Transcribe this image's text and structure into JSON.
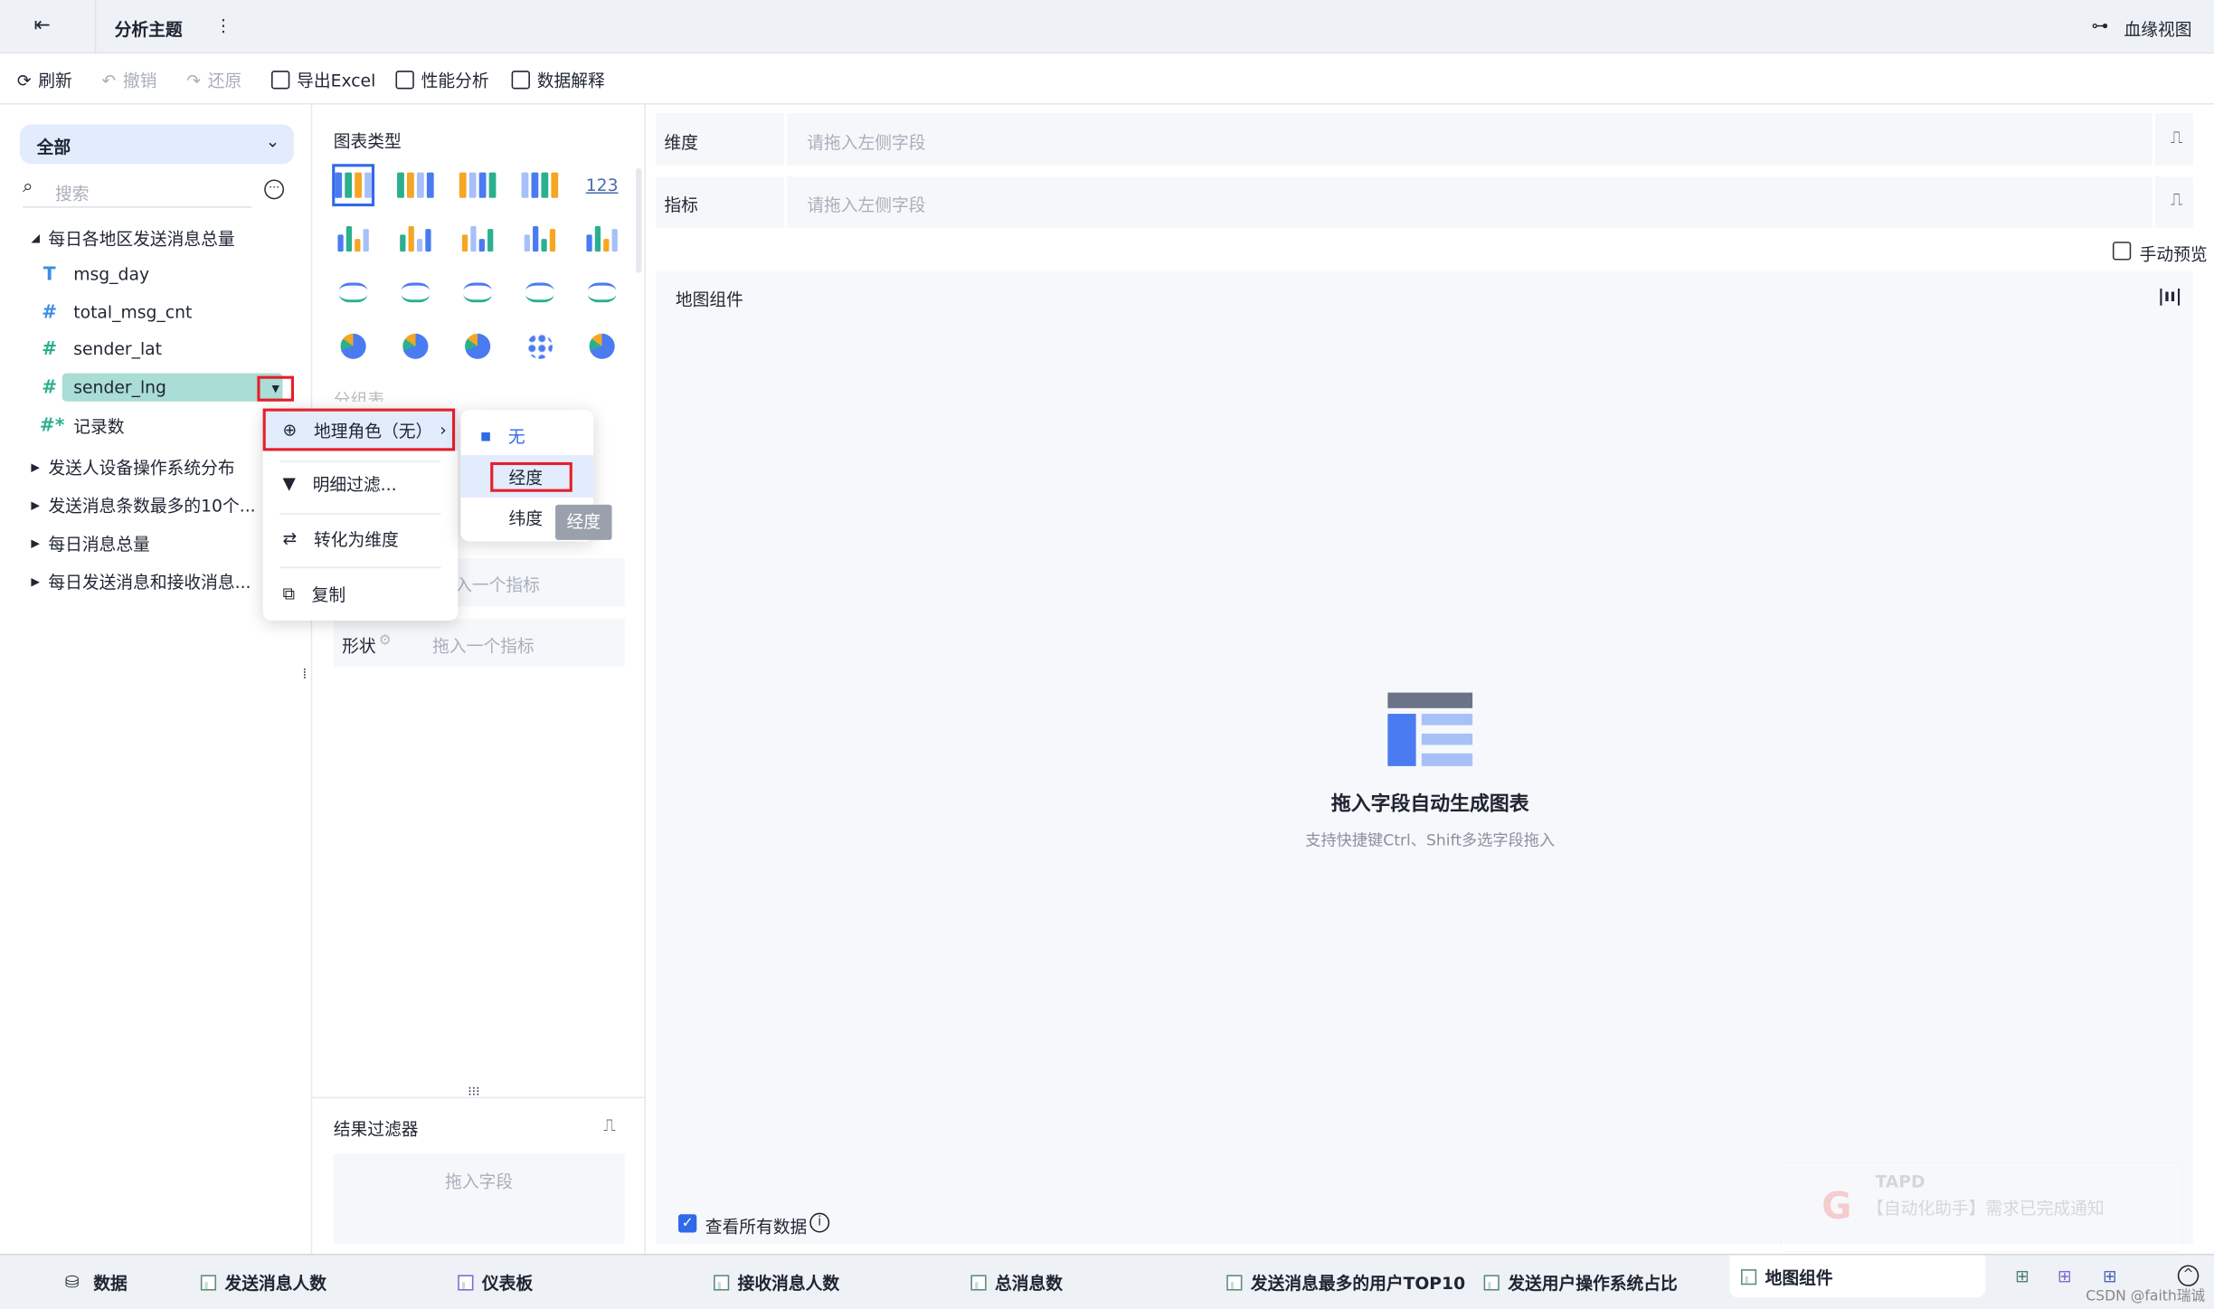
{
  "header": {
    "title": "分析主题",
    "lineage": "血缘视图"
  },
  "toolbar": {
    "refresh": "刷新",
    "undo": "撤销",
    "redo": "还原",
    "export": "导出Excel",
    "perf": "性能分析",
    "explain": "数据解释"
  },
  "left": {
    "scope": "全部",
    "search_placeholder": "搜索",
    "tree": [
      {
        "label": "每日各地区发送消息总量",
        "expanded": true,
        "fields": [
          {
            "icon": "T",
            "name": "msg_day"
          },
          {
            "icon": "#",
            "name": "total_msg_cnt"
          },
          {
            "icon": "#",
            "name": "sender_lat"
          },
          {
            "icon": "#",
            "name": "sender_lng"
          },
          {
            "icon": "#*",
            "name": "记录数"
          }
        ]
      },
      {
        "label": "发送人设备操作系统分布"
      },
      {
        "label": "发送消息条数最多的10个..."
      },
      {
        "label": "每日消息总量"
      },
      {
        "label": "每日发送消息和接收消息..."
      }
    ]
  },
  "middle": {
    "chart_type_title": "图表类型",
    "number_icon": "123",
    "group_label_partial": "分组表",
    "size_placeholder_partial": "入一个指标",
    "shape_label": "形状",
    "shape_placeholder": "拖入一个指标",
    "result_filter": "结果过滤器",
    "drop_field": "拖入字段"
  },
  "context_menu": {
    "items": [
      "地理角色（无）",
      "明细过滤...",
      "转化为维度",
      "复制"
    ],
    "submenu": [
      "无",
      "经度",
      "纬度"
    ],
    "tooltip": "经度"
  },
  "right": {
    "dimension_label": "维度",
    "measure_label": "指标",
    "drop_placeholder": "请拖入左侧字段",
    "manual_preview": "手动预览",
    "canvas_title": "地图组件",
    "empty_title": "拖入字段自动生成图表",
    "empty_sub": "支持快捷键Ctrl、Shift多选字段拖入",
    "view_all": "查看所有数据",
    "notification_title": "TAPD",
    "notification_body": "【自动化助手】需求已完成通知"
  },
  "tabs": [
    "数据",
    "发送消息人数",
    "仪表板",
    "接收消息人数",
    "总消息数",
    "发送消息最多的用户TOP10",
    "发送用户操作系统占比",
    "地图组件"
  ],
  "watermark": "CSDN @faith瑞诚",
  "colors": {
    "accent": "#2f6ae8",
    "highlight": "#a9ddd6",
    "red": "#e5202a"
  }
}
